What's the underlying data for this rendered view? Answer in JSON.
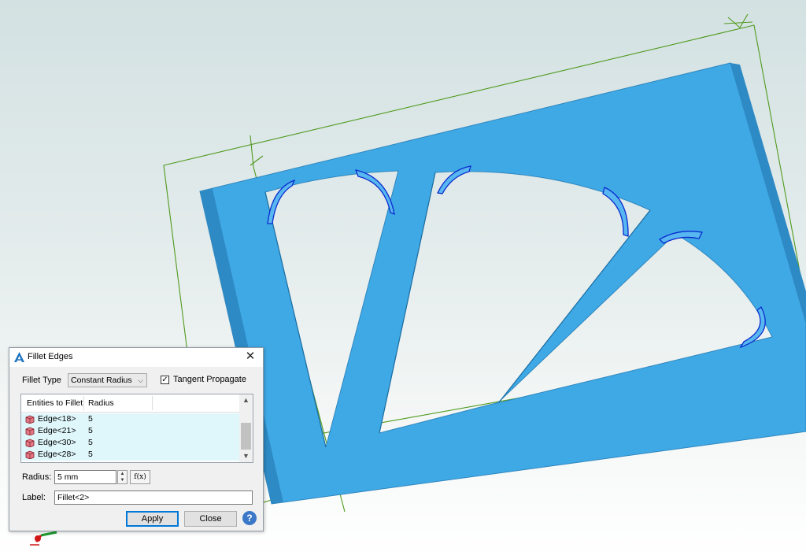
{
  "dialog": {
    "title": "Fillet Edges",
    "close_glyph": "✕",
    "fillet_type_label": "Fillet Type",
    "fillet_type_value": "Constant Radius",
    "tangent_propagate_label": "Tangent Propagate",
    "tangent_propagate_checked": true,
    "table": {
      "col_entities": "Entities to Fillet",
      "col_radius": "Radius",
      "rows": [
        {
          "entity": "Edge<18>",
          "radius": "5"
        },
        {
          "entity": "Edge<21>",
          "radius": "5"
        },
        {
          "entity": "Edge<30>",
          "radius": "5"
        },
        {
          "entity": "Edge<28>",
          "radius": "5"
        }
      ]
    },
    "radius_label": "Radius:",
    "radius_value": "5 mm",
    "fx_label": "f(x)",
    "label_label": "Label:",
    "label_value": "Fillet<2>",
    "apply_label": "Apply",
    "close_label": "Close",
    "help_glyph": "?"
  },
  "icons": {
    "title": "alibre-app-icon",
    "edge": "edge-cube-icon",
    "help": "help-icon"
  },
  "colors": {
    "part_fill": "#3fa9e6",
    "part_shade": "#2f86bd",
    "fillet_highlight": "#0a2bcf",
    "sketch_line": "#4f9a1e",
    "row_highlight": "#dff6fb",
    "primary_button_border": "#0078d7"
  }
}
